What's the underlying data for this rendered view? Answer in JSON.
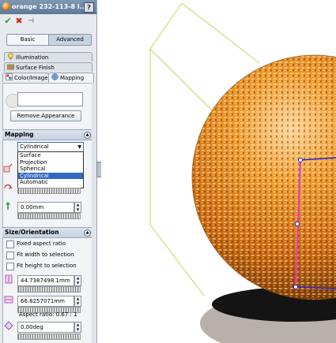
{
  "window": {
    "title": "orange 232-113-8 l...",
    "help_label": "?"
  },
  "toolbar": {
    "ok_glyph": "✔",
    "cancel_glyph": "✖",
    "pin_glyph": "⊣"
  },
  "mode": {
    "basic": "Basic",
    "advanced": "Advanced"
  },
  "tabs": {
    "illumination": "Illumination",
    "surface_finish": "Surface Finish",
    "color_image": "Color/Image",
    "mapping": "Mapping"
  },
  "appearance": {
    "remove_button": "Remove Appearance"
  },
  "mapping_section": {
    "title": "Mapping",
    "selected": "Cylindrical",
    "options": [
      "Surface",
      "Projection",
      "Spherical",
      "Cylindrical",
      "Automatic"
    ],
    "offset_value": "0.00mm"
  },
  "size_section": {
    "title": "Size/Orientation",
    "checkboxes": [
      "Fixed aspect ratio",
      "Fit width to selection",
      "Fit height to selection"
    ],
    "height_value": "44.7387498 1mm",
    "width_value": "66.8257071mm",
    "aspect_ratio": "Aspect ratio: 0.67 : 1",
    "angle_value": "0.00deg"
  },
  "colors": {
    "accent": "#316ac5",
    "title_bar": "#6a84a6",
    "sphere": "#e07b12",
    "bbox": "#c9d15a",
    "selection": "#2a2acc",
    "magenta": "#e03ad0"
  }
}
